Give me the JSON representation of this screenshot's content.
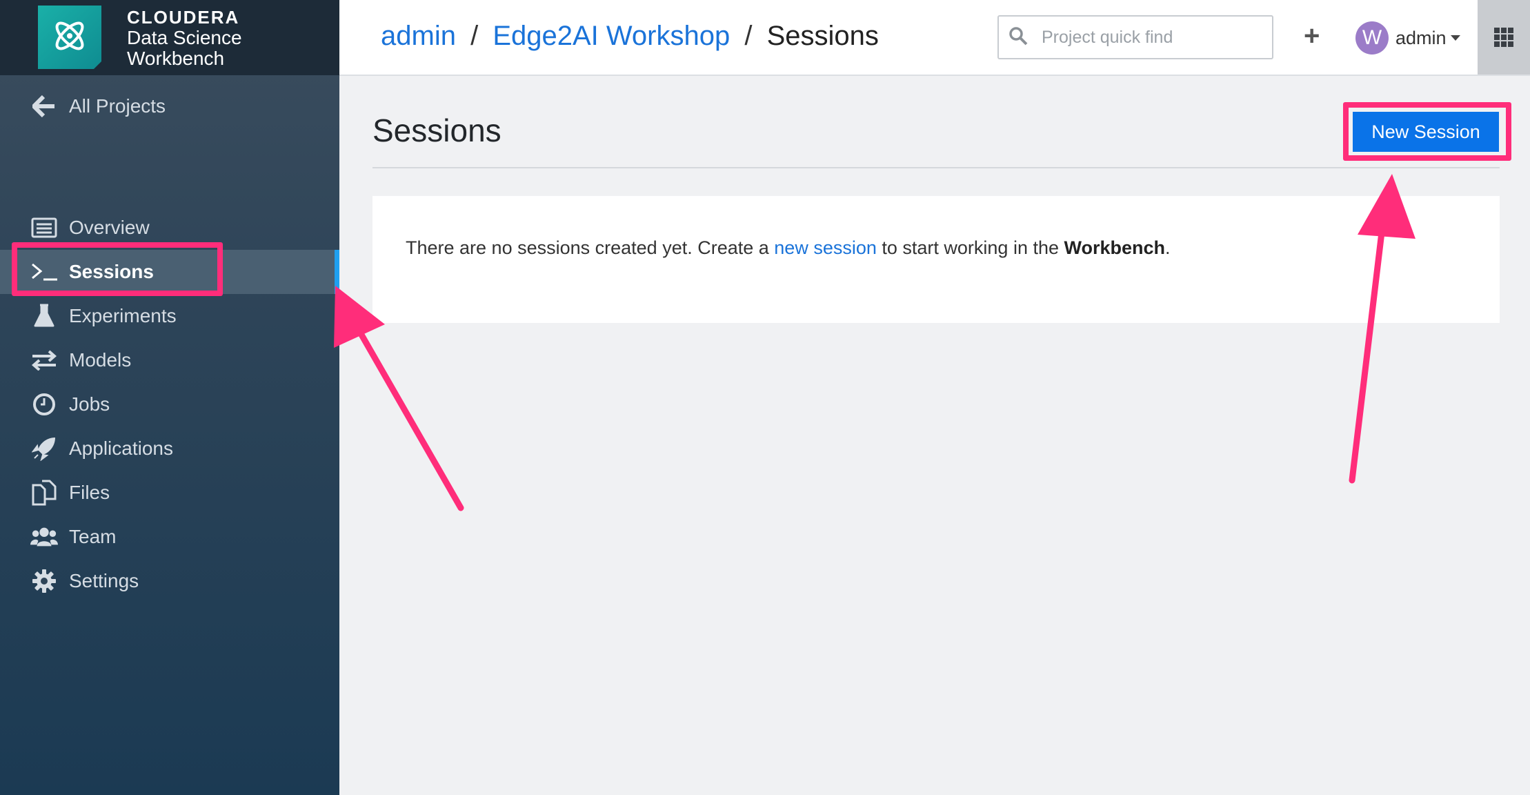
{
  "brand": {
    "company": "CLOUDERA",
    "product_line1": "Data Science",
    "product_line2": "Workbench",
    "logo_icon": "atom-logo-icon"
  },
  "sidebar": {
    "back_label": "All Projects",
    "back_icon": "arrow-left-icon",
    "items": [
      {
        "label": "Overview",
        "icon": "list-icon"
      },
      {
        "label": "Sessions",
        "icon": "terminal-icon",
        "active": true
      },
      {
        "label": "Experiments",
        "icon": "flask-icon"
      },
      {
        "label": "Models",
        "icon": "exchange-icon"
      },
      {
        "label": "Jobs",
        "icon": "clock-icon"
      },
      {
        "label": "Applications",
        "icon": "rocket-icon"
      },
      {
        "label": "Files",
        "icon": "files-icon"
      },
      {
        "label": "Team",
        "icon": "team-icon"
      },
      {
        "label": "Settings",
        "icon": "gear-icon"
      }
    ]
  },
  "header": {
    "breadcrumb": {
      "user": "admin",
      "project": "Edge2AI Workshop",
      "current": "Sessions",
      "separator": "/"
    },
    "search_placeholder": "Project quick find",
    "add_label": "+",
    "avatar_initial": "W",
    "username": "admin"
  },
  "main": {
    "title": "Sessions",
    "new_session_label": "New Session",
    "empty": {
      "prefix": "There are no sessions created yet. Create a ",
      "link": "new session",
      "middle": " to start working in the ",
      "bold": "Workbench",
      "suffix": "."
    }
  },
  "colors": {
    "accent": "#0a73e8",
    "link": "#1a73d9",
    "annotation": "#ff2d7a",
    "sidebar_active_bar": "#1fa0f0"
  }
}
